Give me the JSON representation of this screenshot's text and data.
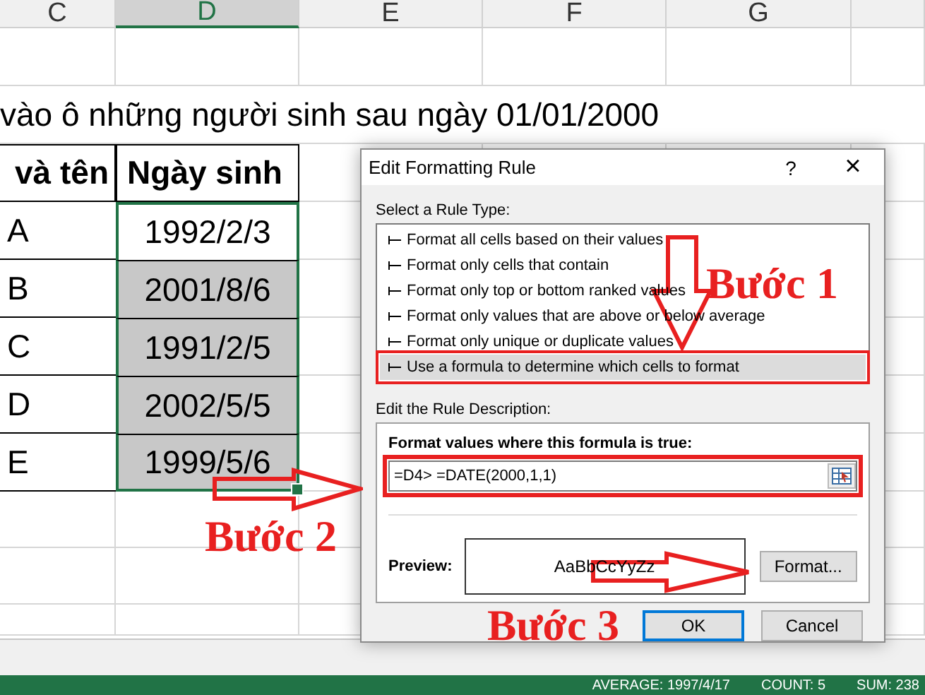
{
  "sheet": {
    "columns": [
      {
        "label": "C",
        "selected": false
      },
      {
        "label": "D",
        "selected": true
      },
      {
        "label": "E",
        "selected": false
      },
      {
        "label": "F",
        "selected": false
      },
      {
        "label": "G",
        "selected": false
      }
    ],
    "title": "vào ô những người sinh sau ngày 01/01/2000",
    "header": [
      "và tên",
      "Ngày sinh"
    ],
    "rows": [
      {
        "name": "A",
        "date": "1992/2/3",
        "highlighted": false
      },
      {
        "name": "B",
        "date": "2001/8/6",
        "highlighted": true
      },
      {
        "name": "C",
        "date": "1991/2/5",
        "highlighted": true
      },
      {
        "name": "D",
        "date": "2002/5/5",
        "highlighted": true
      },
      {
        "name": "E",
        "date": "1999/5/6",
        "highlighted": true
      }
    ]
  },
  "dialog": {
    "title": "Edit Formatting Rule",
    "help": "?",
    "close": "×",
    "rule_type_label": "Select a Rule Type:",
    "rule_types": [
      {
        "label": "Format all cells based on their values",
        "selected": false,
        "marked": false
      },
      {
        "label": "Format only cells that contain",
        "selected": false,
        "marked": false
      },
      {
        "label": "Format only top or bottom ranked values",
        "selected": false,
        "marked": false
      },
      {
        "label": "Format only values that are above or below average",
        "selected": false,
        "marked": false
      },
      {
        "label": "Format only unique or duplicate values",
        "selected": false,
        "marked": false
      },
      {
        "label": "Use a formula to determine which cells to format",
        "selected": true,
        "marked": true
      }
    ],
    "description_label": "Edit the Rule Description:",
    "formula_label": "Format values where this formula is true:",
    "formula": {
      "value": "=D4> =DATE(2000,1,1)",
      "marked": true
    },
    "preview_label": "Preview:",
    "preview_text": "AaBbCcYyZz",
    "format_button": "Format...",
    "buttons": [
      {
        "label": "OK",
        "selected": true
      },
      {
        "label": "Cancel",
        "selected": false
      }
    ]
  },
  "annotations": [
    {
      "label": "Bước 1"
    },
    {
      "label": "Bước 2"
    },
    {
      "label": "Bước 3"
    }
  ],
  "status_bar": [
    "AVERAGE: 1997/4/17",
    "COUNT: 5",
    "SUM: 238"
  ]
}
